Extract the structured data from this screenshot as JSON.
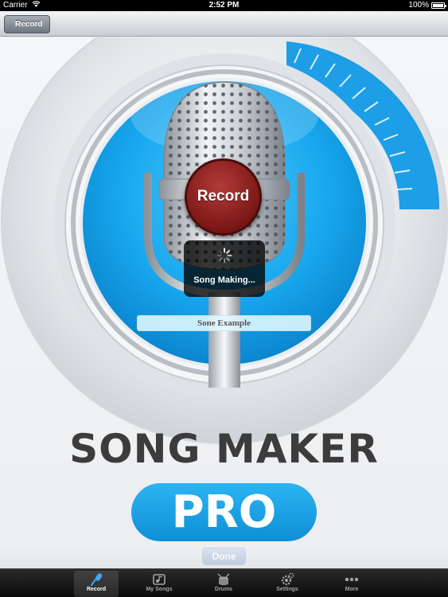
{
  "status_bar": {
    "carrier": "Carrier",
    "time": "2:52 PM",
    "battery": "100%"
  },
  "nav": {
    "back_label": "Record"
  },
  "main": {
    "record_button_label": "Record",
    "progress_text": "Song Making...",
    "song_name": "Sone Example",
    "title": "SONG MAKER",
    "subtitle": "PRO"
  },
  "toolbar": {
    "done_label": "Done"
  },
  "tabs": [
    {
      "label": "Record",
      "icon": "microphone-icon",
      "active": true
    },
    {
      "label": "My Songs",
      "icon": "music-folder-icon",
      "active": false
    },
    {
      "label": "Drums",
      "icon": "drum-icon",
      "active": false
    },
    {
      "label": "Settings",
      "icon": "gear-icon",
      "active": false
    },
    {
      "label": "More",
      "icon": "more-dots-icon",
      "active": false
    }
  ],
  "colors": {
    "accent_blue": "#1aa4ec",
    "record_red": "#8b1f1d",
    "title_gray": "#3c3c3c"
  }
}
